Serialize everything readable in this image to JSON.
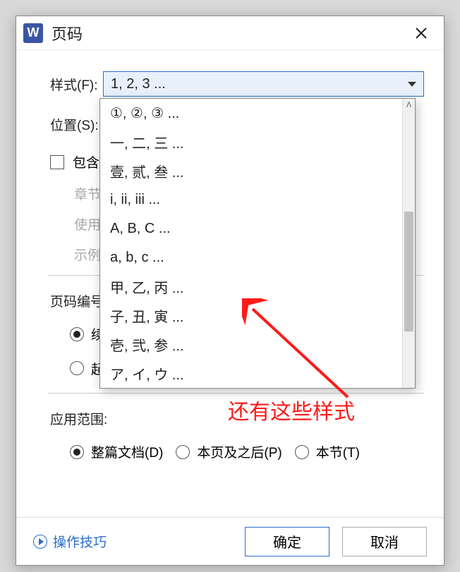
{
  "app_icon_letter": "W",
  "title": "页码",
  "labels": {
    "style": "样式(F):",
    "position": "位置(S):",
    "include_chapter": "包含章",
    "chapter_start": "章节起",
    "use_separator": "使用分",
    "example": "示例:",
    "page_numbering": "页码编号",
    "continue": "续",
    "start_at": "起始页码(A):",
    "apply_to": "应用范围:",
    "whole_doc": "整篇文档(D)",
    "this_page_after": "本页及之后(P)",
    "this_section": "本节(T)"
  },
  "combo_value": "1, 2, 3 ...",
  "dropdown_options": [
    "①, ②, ③ ...",
    "一, 二, 三 ...",
    "壹, 贰, 叁 ...",
    "i, ii, iii ...",
    "A, B, C ...",
    "a, b, c ...",
    "甲, 乙, 丙 ...",
    "子, 丑, 寅 ...",
    "壱, 弐, 参 ...",
    "ア, イ, ウ ..."
  ],
  "annotation_text": "还有这些样式",
  "footer": {
    "tips": "操作技巧",
    "ok": "确定",
    "cancel": "取消"
  }
}
